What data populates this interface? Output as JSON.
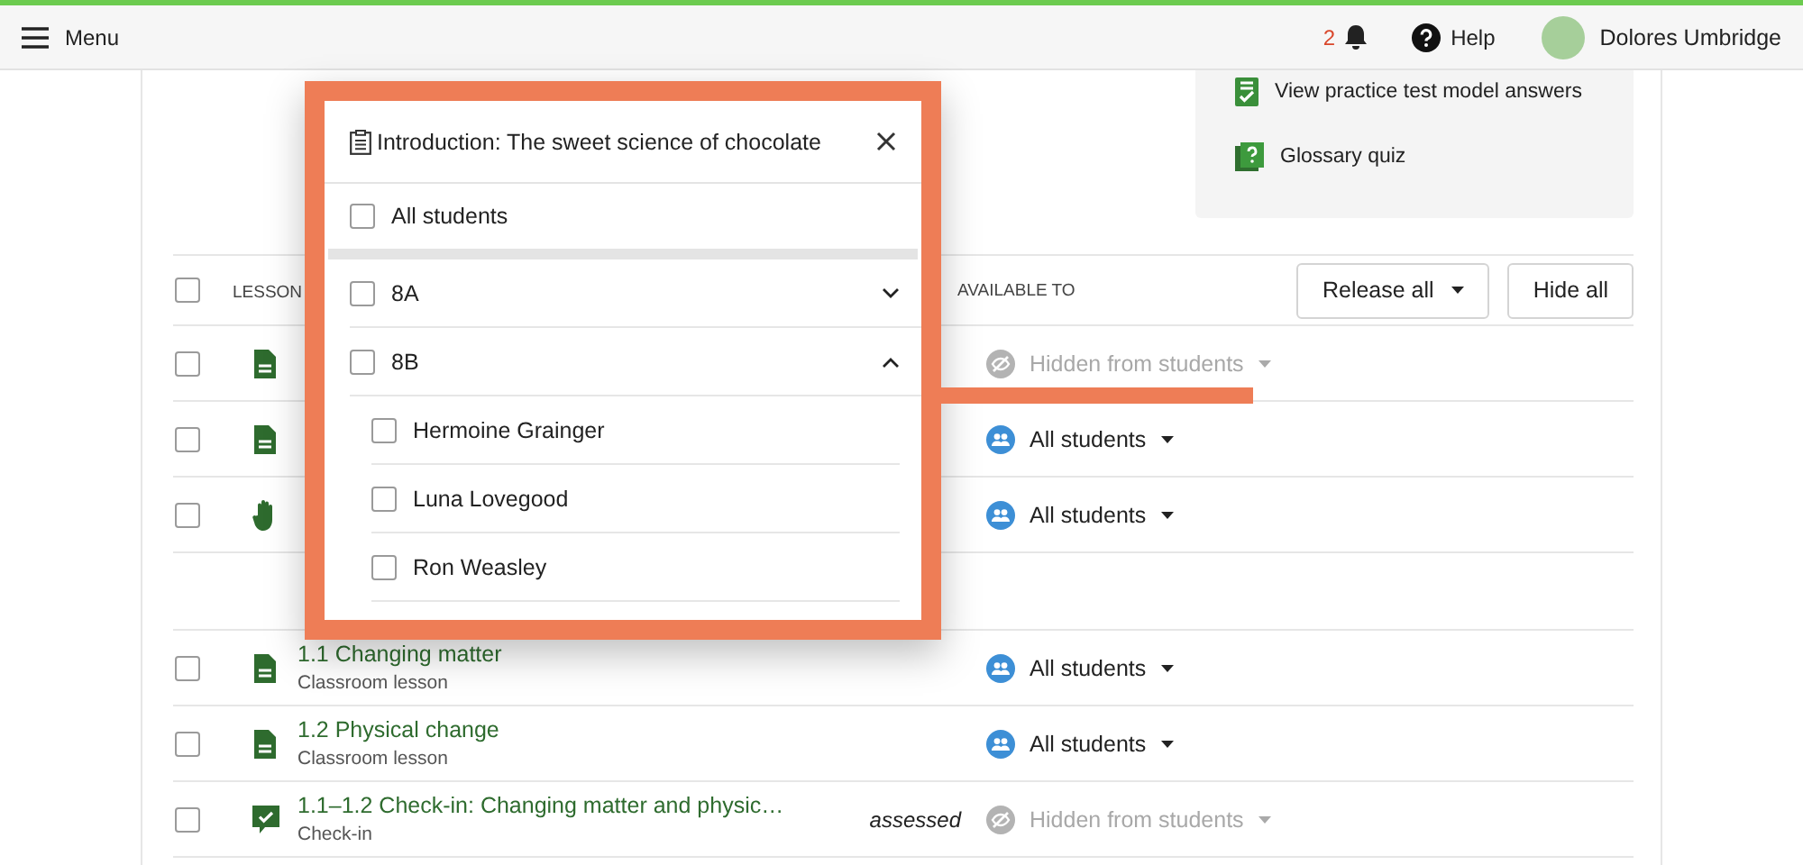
{
  "topbar": {
    "menu_label": "Menu",
    "notification_count": "2",
    "help_label": "Help",
    "user_name": "Dolores Umbridge"
  },
  "side_panel": {
    "links": [
      {
        "label": "View practice test model answers",
        "kind": "checklist"
      },
      {
        "label": "Glossary quiz",
        "kind": "quiz"
      }
    ]
  },
  "table": {
    "select_all_checked": false,
    "columns": [
      "LESSON",
      "AVAILABLE TO"
    ],
    "buttons": [
      {
        "label": "Release all",
        "has_menu": true
      },
      {
        "label": "Hide all",
        "has_menu": false
      }
    ],
    "groups": [
      {
        "rows": [
          {
            "kind": "document",
            "checked": false,
            "availability": {
              "label": "Hidden from students",
              "hidden": true
            }
          },
          {
            "kind": "document",
            "checked": false,
            "availability": {
              "label": "All students",
              "hidden": false
            }
          },
          {
            "kind": "hand",
            "checked": false,
            "availability": {
              "label": "All students",
              "hidden": false
            }
          }
        ]
      },
      {
        "rows": [
          {
            "title": "1.1 Changing matter",
            "subtitle": "Classroom lesson",
            "kind": "document",
            "checked": false,
            "availability": {
              "label": "All students",
              "hidden": false
            }
          },
          {
            "title": "1.2 Physical change",
            "subtitle": "Classroom lesson",
            "kind": "document",
            "checked": false,
            "availability": {
              "label": "All students",
              "hidden": false
            }
          },
          {
            "title": "1.1–1.2 Check-in: Changing matter and physic…",
            "subtitle": "Check-in",
            "kind": "checkin",
            "tag": "assessed",
            "checked": false,
            "availability": {
              "label": "Hidden from students",
              "hidden": true
            }
          }
        ]
      }
    ]
  },
  "popup": {
    "title": "Introduction: The sweet science of chocolate",
    "all_students": {
      "label": "All students",
      "checked": false
    },
    "classes": [
      {
        "name": "8A",
        "checked": false,
        "expanded": false
      },
      {
        "name": "8B",
        "checked": false,
        "expanded": true,
        "students": [
          {
            "name": "Hermoine Grainger",
            "checked": false
          },
          {
            "name": "Luna Lovegood",
            "checked": false
          },
          {
            "name": "Ron Weasley",
            "checked": false
          }
        ]
      }
    ]
  }
}
